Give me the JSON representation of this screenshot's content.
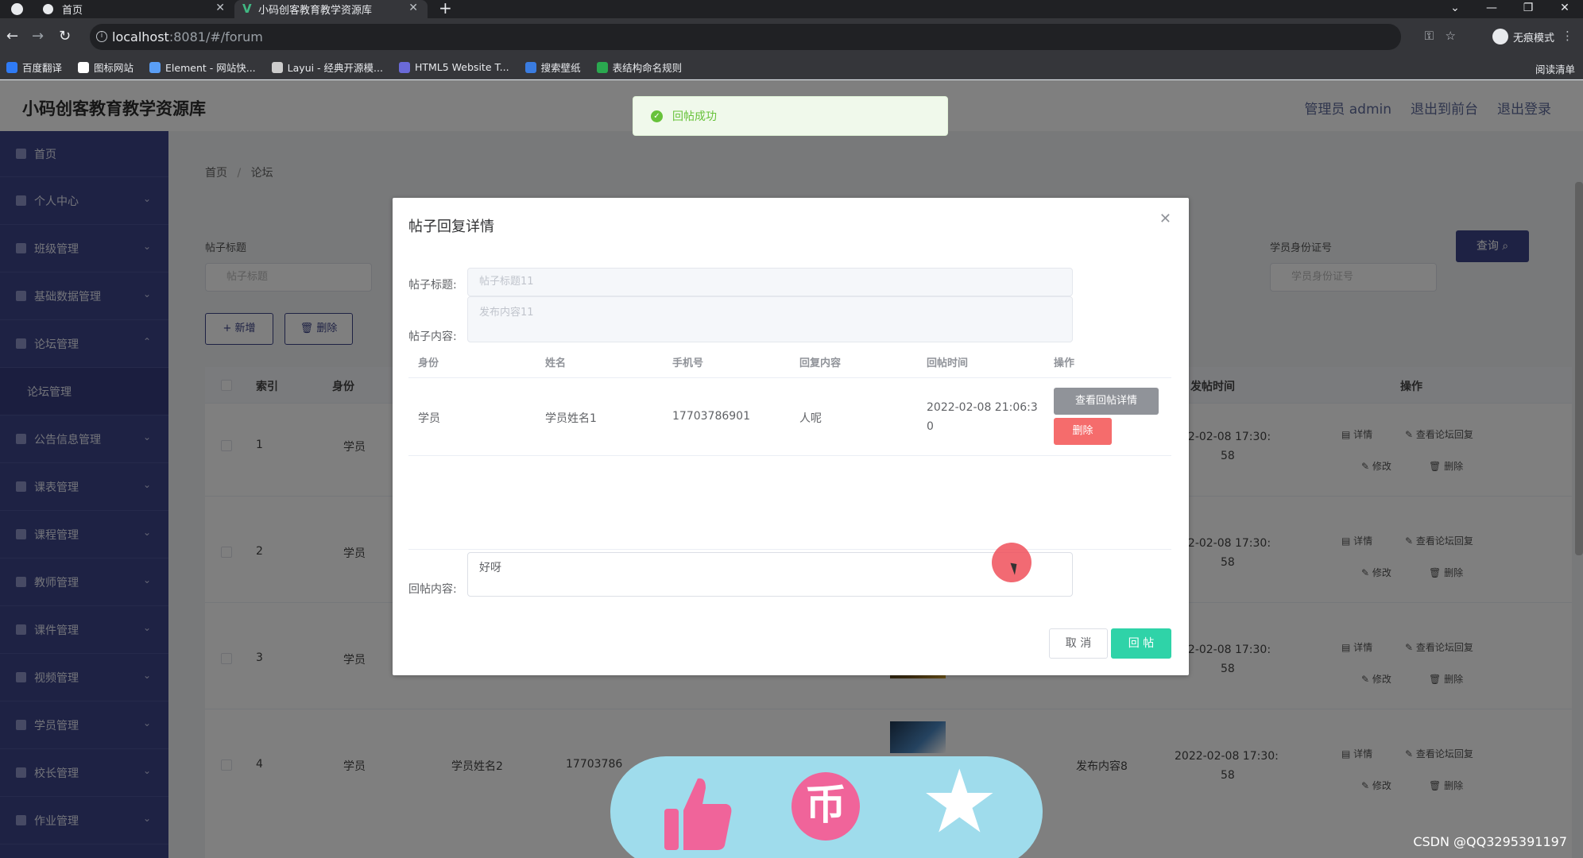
{
  "browser": {
    "tabs": [
      {
        "label": "首页"
      },
      {
        "label": "小码创客教育教学资源库"
      }
    ],
    "new_tab": "+",
    "url_host": "localhost",
    "url_path": ":8081/#/forum",
    "profile_label": "无痕模式",
    "bookmarks": [
      {
        "label": "百度翻译",
        "color": "#2f7bf5"
      },
      {
        "label": "图标网站",
        "color": "#ffffff"
      },
      {
        "label": "Element - 网站快...",
        "color": "#5a9ef5"
      },
      {
        "label": "Layui - 经典开源模...",
        "color": "#cccccc"
      },
      {
        "label": "HTML5 Website T...",
        "color": "#6a6ad8"
      },
      {
        "label": "搜索壁纸",
        "color": "#3a7ce0"
      },
      {
        "label": "表结构命名规则",
        "color": "#2aa84f"
      }
    ],
    "reading_list": "阅读清单"
  },
  "app": {
    "title": "小码创客教育教学资源库",
    "header_links": [
      "管理员 admin",
      "退出到前台",
      "退出登录"
    ],
    "accent": "#3d4488"
  },
  "sidebar": {
    "items": [
      {
        "label": "首页",
        "expand": false
      },
      {
        "label": "个人中心",
        "expand": true
      },
      {
        "label": "班级管理",
        "expand": true
      },
      {
        "label": "基础数据管理",
        "expand": true
      },
      {
        "label": "论坛管理",
        "expand": true
      },
      {
        "label": "论坛管理",
        "sub": true
      },
      {
        "label": "公告信息管理",
        "expand": true
      },
      {
        "label": "课表管理",
        "expand": true
      },
      {
        "label": "课程管理",
        "expand": true
      },
      {
        "label": "教师管理",
        "expand": true
      },
      {
        "label": "课件管理",
        "expand": true
      },
      {
        "label": "视频管理",
        "expand": true
      },
      {
        "label": "学员管理",
        "expand": true
      },
      {
        "label": "校长管理",
        "expand": true
      },
      {
        "label": "作业管理",
        "expand": true
      }
    ]
  },
  "main": {
    "breadcrumb": [
      "首页",
      "论坛"
    ],
    "filters": {
      "post_title_label": "帖子标题",
      "post_title_placeholder": "帖子标题",
      "student_id_label": "学员身份证号",
      "student_id_placeholder": "学员身份证号",
      "query_button": "查询"
    },
    "add_button": "+ 新增",
    "delete_button": "删除",
    "table": {
      "headers": [
        "索引",
        "身份",
        "发帖时间",
        "操作"
      ],
      "rows": [
        {
          "index": "1",
          "identity": "学员",
          "name": "",
          "phone": "",
          "content": "",
          "time_1": "22-02-08 17:30:",
          "time_2": "58"
        },
        {
          "index": "2",
          "identity": "学员",
          "name": "",
          "phone": "",
          "content": "",
          "time_1": "22-02-08 17:30:",
          "time_2": "58"
        },
        {
          "index": "3",
          "identity": "学员",
          "name": "",
          "phone": "",
          "content": "",
          "time_1": "22-02-08 17:30:",
          "time_2": "58"
        },
        {
          "index": "4",
          "identity": "学员",
          "name": "学员姓名2",
          "phone": "17703786",
          "content": "发布内容8",
          "time_1": "2022-02-08 17:30:",
          "time_2": "58"
        }
      ],
      "ops": {
        "detail": "详情",
        "view_replies": "查看论坛回复",
        "edit": "修改",
        "delete": "删除"
      }
    }
  },
  "toast": {
    "text": "回帖成功"
  },
  "dialog": {
    "title": "帖子回复详情",
    "post_title_label": "帖子标题:",
    "post_title_value": "帖子标题11",
    "post_content_label": "帖子内容:",
    "post_content_value": "发布内容11",
    "columns": [
      "身份",
      "姓名",
      "手机号",
      "回复内容",
      "回帖时间",
      "操作"
    ],
    "row": {
      "identity": "学员",
      "name": "学员姓名1",
      "phone": "17703786901",
      "content": "人呢",
      "time_1": "2022-02-08 21:06:3",
      "time_2": "0",
      "view_btn": "查看回帖详情",
      "delete_btn": "删除"
    },
    "reply_label": "回帖内容:",
    "reply_value": "好呀",
    "cancel_btn": "取 消",
    "submit_btn": "回 帖"
  },
  "watermark": "CSDN @QQ3295391197"
}
